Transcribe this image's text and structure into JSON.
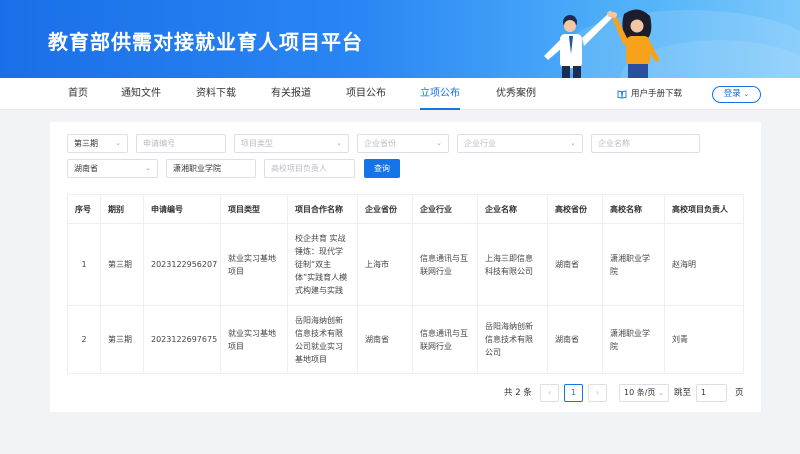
{
  "banner": {
    "title": "教育部供需对接就业育人项目平台"
  },
  "nav": {
    "items": [
      "首页",
      "通知文件",
      "资料下载",
      "有关报道",
      "项目公布",
      "立项公布",
      "优秀案例"
    ],
    "active_index": 5,
    "manual_label": "用户手册下载",
    "login_label": "登录"
  },
  "filters": {
    "batch": {
      "value": "第三期",
      "icon": "chevron-down-icon"
    },
    "app_no": {
      "placeholder": "申请编号"
    },
    "project_type": {
      "placeholder": "项目类型"
    },
    "company_province": {
      "placeholder": "企业省份"
    },
    "company_industry": {
      "placeholder": "企业行业"
    },
    "company_name": {
      "placeholder": "企业名称"
    },
    "school_province": {
      "value": "湖南省"
    },
    "school_name": {
      "value": "潇湘职业学院"
    },
    "school_leader": {
      "placeholder": "高校项目负责人"
    },
    "search_label": "查询"
  },
  "table": {
    "headers": [
      "序号",
      "期别",
      "申请编号",
      "项目类型",
      "项目合作名称",
      "企业省份",
      "企业行业",
      "企业名称",
      "高校省份",
      "高校名称",
      "高校项目负责人"
    ],
    "rows": [
      [
        "1",
        "第三期",
        "2023122956207",
        "就业实习基地项目",
        "校企共育 实战锤炼：现代学徒制“双主体”实践育人模式构建与实践",
        "上海市",
        "信息通讯与互联网行业",
        "上海三即信息科技有限公司",
        "湖南省",
        "潇湘职业学院",
        "赵海明"
      ],
      [
        "2",
        "第三期",
        "2023122697675",
        "就业实习基地项目",
        "岳阳海纳创新信息技术有限公司就业实习基地项目",
        "湖南省",
        "信息通讯与互联网行业",
        "岳阳海纳创新信息技术有限公司",
        "湖南省",
        "潇湘职业学院",
        "刘青"
      ]
    ]
  },
  "pagination": {
    "total_text": "共 2 条",
    "prev": "‹",
    "current": "1",
    "next": "›",
    "page_size": "10 条/页",
    "jump_label": "跳至",
    "jump_value": "1",
    "page_suffix": "页"
  },
  "colors": {
    "primary": "#1473e6",
    "banner_start": "#1a6fe8",
    "banner_end": "#7cc8fb"
  }
}
